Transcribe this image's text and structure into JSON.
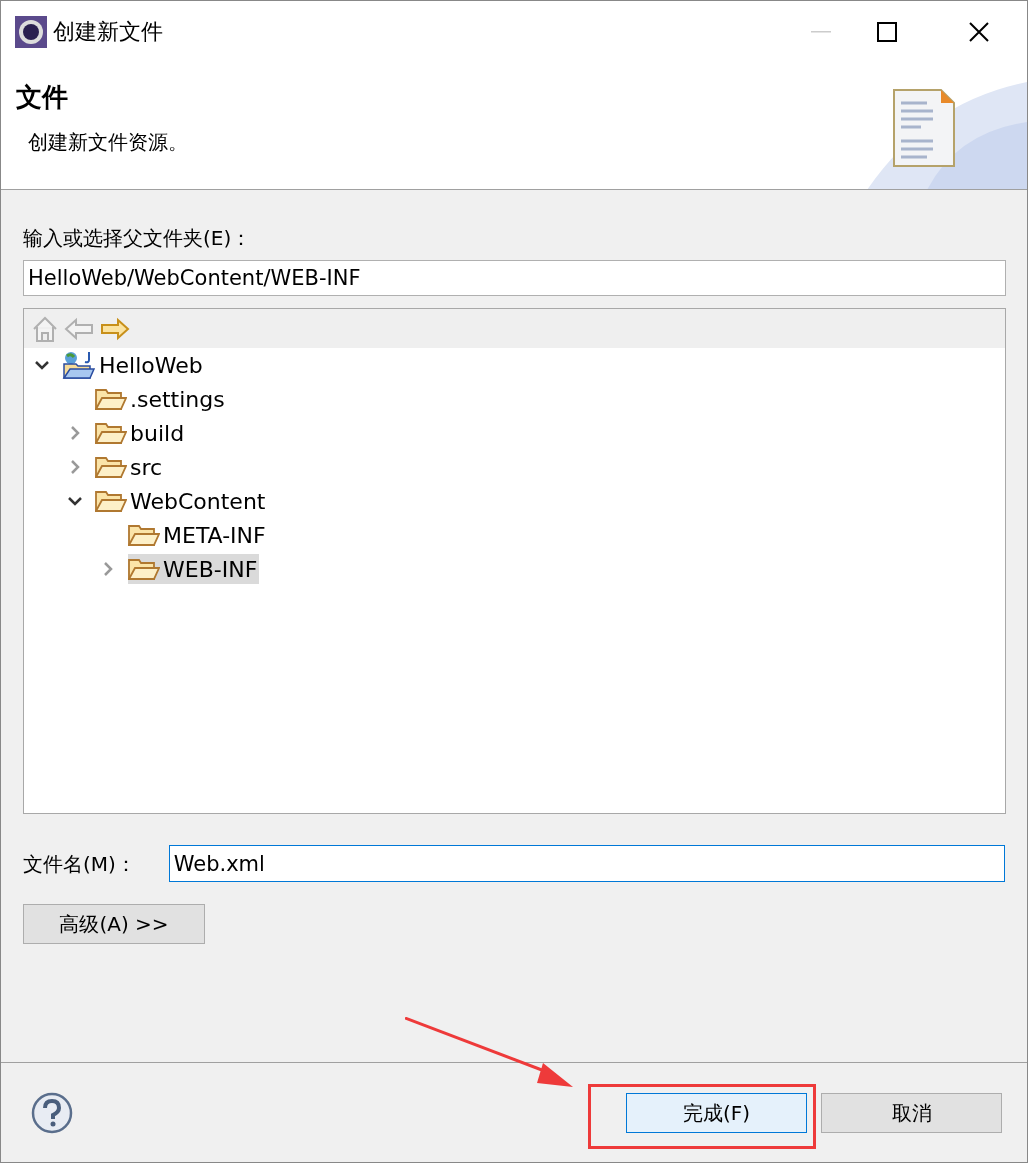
{
  "window": {
    "title": "创建新文件"
  },
  "header": {
    "title": "文件",
    "description": "创建新文件资源。"
  },
  "folder_field": {
    "label": "输入或选择父文件夹(E)：",
    "value": "HelloWeb/WebContent/WEB-INF"
  },
  "tree": {
    "toolbar": [
      {
        "kind": "home",
        "disabled": true
      },
      {
        "kind": "back",
        "disabled": true
      },
      {
        "kind": "forward",
        "disabled": false
      }
    ],
    "items": [
      {
        "label": "HelloWeb",
        "kind": "project",
        "expandable": true,
        "expanded": true,
        "selected": false,
        "children": [
          {
            "label": ".settings",
            "kind": "folder",
            "expandable": false,
            "selected": false
          },
          {
            "label": "build",
            "kind": "folder",
            "expandable": true,
            "expanded": false,
            "selected": false
          },
          {
            "label": "src",
            "kind": "folder",
            "expandable": true,
            "expanded": false,
            "selected": false
          },
          {
            "label": "WebContent",
            "kind": "folder",
            "expandable": true,
            "expanded": true,
            "selected": false,
            "children": [
              {
                "label": "META-INF",
                "kind": "folder",
                "expandable": false,
                "selected": false
              },
              {
                "label": "WEB-INF",
                "kind": "folder",
                "expandable": true,
                "expanded": false,
                "selected": true
              }
            ]
          }
        ]
      }
    ]
  },
  "name_field": {
    "label": "文件名(M)：",
    "value": "Web.xml"
  },
  "advanced_button": "高级(A) >>",
  "buttons": [
    {
      "label": "完成(F)",
      "default": true
    },
    {
      "label": "取消",
      "default": false
    }
  ],
  "annotation": {
    "highlight_box": true,
    "arrow": true
  }
}
